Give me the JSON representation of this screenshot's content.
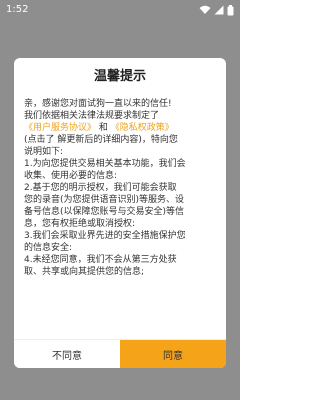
{
  "status_bar": {
    "time": "1:52"
  },
  "dialog": {
    "title": "温馨提示",
    "intro": {
      "line1": "亲，感谢您对面试狗一直以来的信任!",
      "line2": "我们依据相关法律法规要求制定了",
      "link_user_agreement": "《用户服务协议》",
      "conjunction": "和",
      "link_privacy_policy": "《隐私权政策》",
      "line4": "(点击了 解更新后的详细内容)，特向您",
      "line5": "说明如下:"
    },
    "items": {
      "item1": {
        "line1": "1.为向您提供交易相关基本功能，我们会",
        "line2": "收集、使用必要的信息:"
      },
      "item2": {
        "line1": "2.基于您的明示授权，我们可能会获取",
        "line2": "您的录音(为您提供语音识别)等服务、设",
        "line3": "备号信息(以保障您账号与交易安全)等信",
        "line4": "息，您有权拒绝或取消授权:"
      },
      "item3": {
        "line1": "3.我们会采取业界先进的安全措施保护您",
        "line2": "的信息安全:"
      },
      "item4": {
        "line1": "4.未经您同意，我们不会从第三方处获",
        "line2": "取、共享或向其提供您的信息;"
      }
    },
    "buttons": {
      "decline": "不同意",
      "agree": "同意"
    }
  },
  "colors": {
    "accent": "#f5a319",
    "link": "#f0a21a",
    "overlay": "#8e8e8e"
  }
}
